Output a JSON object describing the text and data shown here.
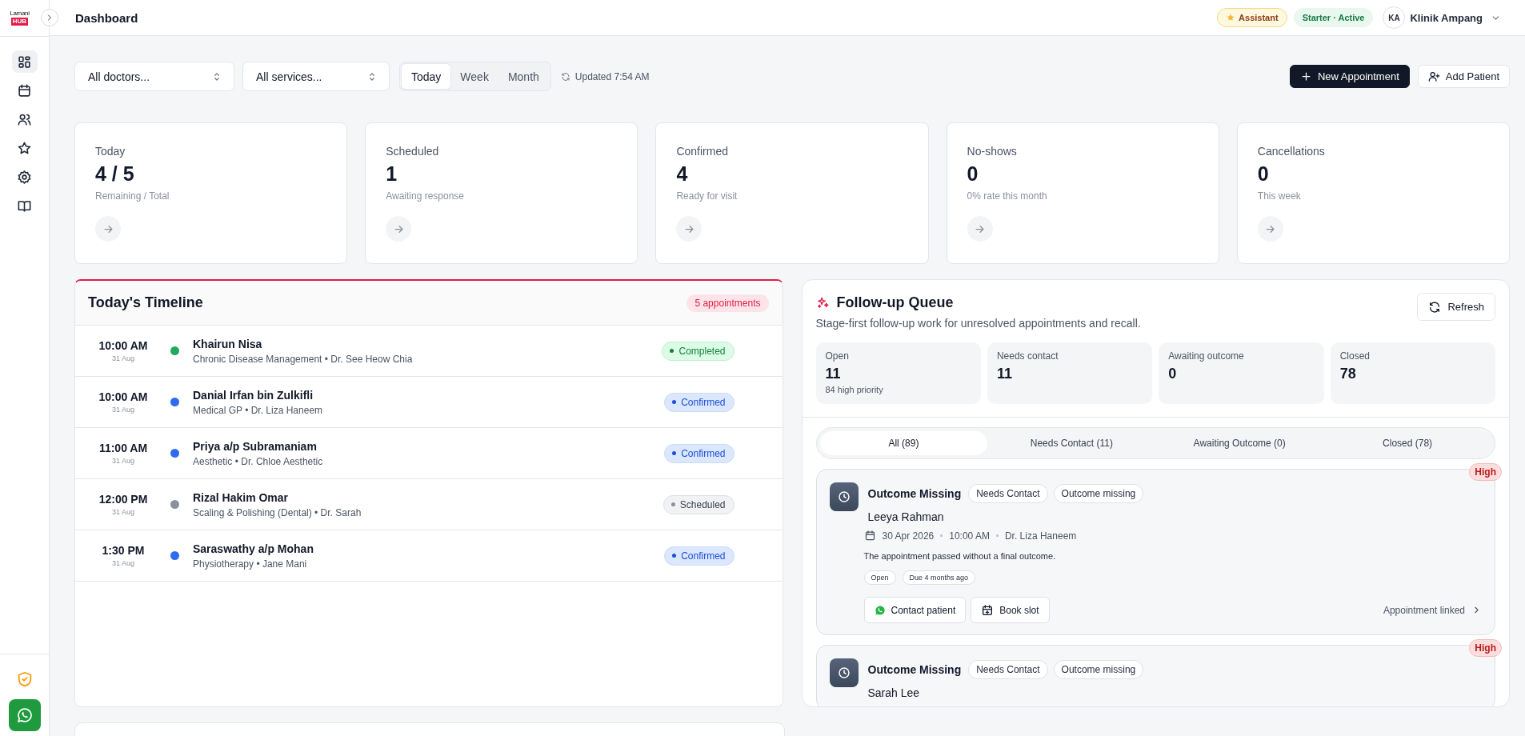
{
  "logo": {
    "wordmark": "Lamani",
    "badge": "HUB"
  },
  "header": {
    "title": "Dashboard",
    "assistant_badge": "Assistant",
    "plan_badge": "Starter · Active",
    "avatar_initials": "KA",
    "clinic_name": "Klinik Ampang"
  },
  "sidebar": {
    "items": [
      {
        "selected": true
      },
      {
        "selected": false
      },
      {
        "selected": false
      },
      {
        "selected": false
      },
      {
        "selected": false
      },
      {
        "selected": false
      }
    ]
  },
  "filters": {
    "doctor": "All doctors...",
    "service": "All services...",
    "periods": [
      {
        "label": "Today",
        "selected": true
      },
      {
        "label": "Week",
        "selected": false
      },
      {
        "label": "Month",
        "selected": false
      }
    ],
    "updated": "Updated 7:54 AM"
  },
  "actions": [
    {
      "label": "New Appointment",
      "kind": "primary"
    },
    {
      "label": "Add Patient",
      "kind": "secondary"
    }
  ],
  "stats": [
    {
      "label": "Today",
      "value": "4 / 5",
      "caption": "Remaining / Total"
    },
    {
      "label": "Scheduled",
      "value": "1",
      "caption": "Awaiting response"
    },
    {
      "label": "Confirmed",
      "value": "4",
      "caption": "Ready for visit"
    },
    {
      "label": "No-shows",
      "value": "0",
      "caption": "0% rate this month"
    },
    {
      "label": "Cancellations",
      "value": "0",
      "caption": "This week"
    }
  ],
  "timeline": {
    "title": "Today's Timeline",
    "count_badge": "5 appointments",
    "rows": [
      {
        "time": "10:00 AM",
        "date": "31 Aug",
        "name": "Khairun Nisa",
        "details": "Chronic Disease Management • Dr. See Heow Chia",
        "status": "Completed",
        "kind": "completed",
        "color": "#22a861"
      },
      {
        "time": "10:00 AM",
        "date": "31 Aug",
        "name": "Danial Irfan bin Zulkifli",
        "details": "Medical GP • Dr. Liza Haneem",
        "status": "Confirmed",
        "kind": "confirmed",
        "color": "#2f6bf0"
      },
      {
        "time": "11:00 AM",
        "date": "31 Aug",
        "name": "Priya a/p Subramaniam",
        "details": "Aesthetic • Dr. Chloe Aesthetic",
        "status": "Confirmed",
        "kind": "confirmed",
        "color": "#2f6bf0"
      },
      {
        "time": "12:00 PM",
        "date": "31 Aug",
        "name": "Rizal Hakim Omar",
        "details": "Scaling & Polishing (Dental) • Dr. Sarah",
        "status": "Scheduled",
        "kind": "scheduled",
        "color": "#8a909c"
      },
      {
        "time": "1:30 PM",
        "date": "31 Aug",
        "name": "Saraswathy a/p Mohan",
        "details": "Physiotherapy • Jane Mani",
        "status": "Confirmed",
        "kind": "confirmed",
        "color": "#2f6bf0"
      }
    ]
  },
  "followup": {
    "title": "Follow-up Queue",
    "subtitle": "Stage-first follow-up work for unresolved appointments and recall.",
    "refresh": "Refresh",
    "summary": [
      {
        "label": "Open",
        "value": "11",
        "note": "84 high priority"
      },
      {
        "label": "Needs contact",
        "value": "11"
      },
      {
        "label": "Awaiting outcome",
        "value": "0"
      },
      {
        "label": "Closed",
        "value": "78"
      }
    ],
    "tabs": [
      {
        "label": "All (89)",
        "selected": true
      },
      {
        "label": "Needs Contact (11)",
        "selected": false
      },
      {
        "label": "Awaiting Outcome (0)",
        "selected": false
      },
      {
        "label": "Closed (78)",
        "selected": false
      }
    ],
    "items": [
      {
        "title": "Outcome Missing",
        "tags": [
          "Needs Contact",
          "Outcome missing"
        ],
        "priority": "High",
        "patient": "Leeya Rahman",
        "date": "30 Apr 2026",
        "time": "10:00 AM",
        "doctor": "Dr. Liza Haneem",
        "message": "The appointment passed without a final outcome.",
        "chips": [
          "Open",
          "Due 4 months ago"
        ],
        "contact": "Contact patient",
        "book": "Book slot",
        "link": "Appointment linked"
      },
      {
        "title": "Outcome Missing",
        "tags": [
          "Needs Contact",
          "Outcome missing"
        ],
        "priority": "High",
        "patient": "Sarah Lee"
      }
    ]
  }
}
